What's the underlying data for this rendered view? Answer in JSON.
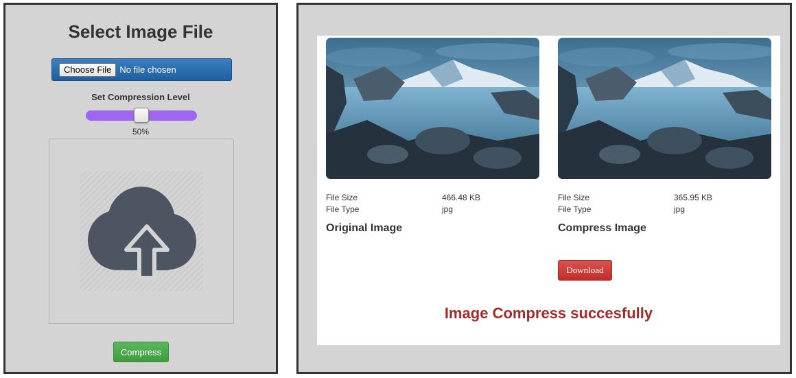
{
  "left": {
    "title": "Select Image File",
    "file_input": {
      "button_label": "Choose File",
      "status": "No file chosen"
    },
    "compression": {
      "label": "Set Compression Level",
      "value_text": "50%",
      "level": 0.5,
      "track_color": "#a066f0"
    },
    "upload_icon": "cloud-upload-icon",
    "compress_button": "Compress"
  },
  "right": {
    "original": {
      "image_icon": "landscape-photo",
      "size_label": "File Size",
      "size_value": "466.48 KB",
      "type_label": "File Type",
      "type_value": "jpg",
      "caption": "Original Image"
    },
    "compressed": {
      "image_icon": "landscape-photo",
      "size_label": "File Size",
      "size_value": "365.95 KB",
      "type_label": "File Type",
      "type_value": "jpg",
      "caption": "Compress Image"
    },
    "download_button": "Download",
    "message": "Image Compress succesfully"
  },
  "colors": {
    "panel_bg": "#d4d4d4",
    "file_bar": "#2a6aa9",
    "compress_btn": "#4cae4c",
    "download_btn": "#cc3c38",
    "message": "#a52a2a"
  }
}
